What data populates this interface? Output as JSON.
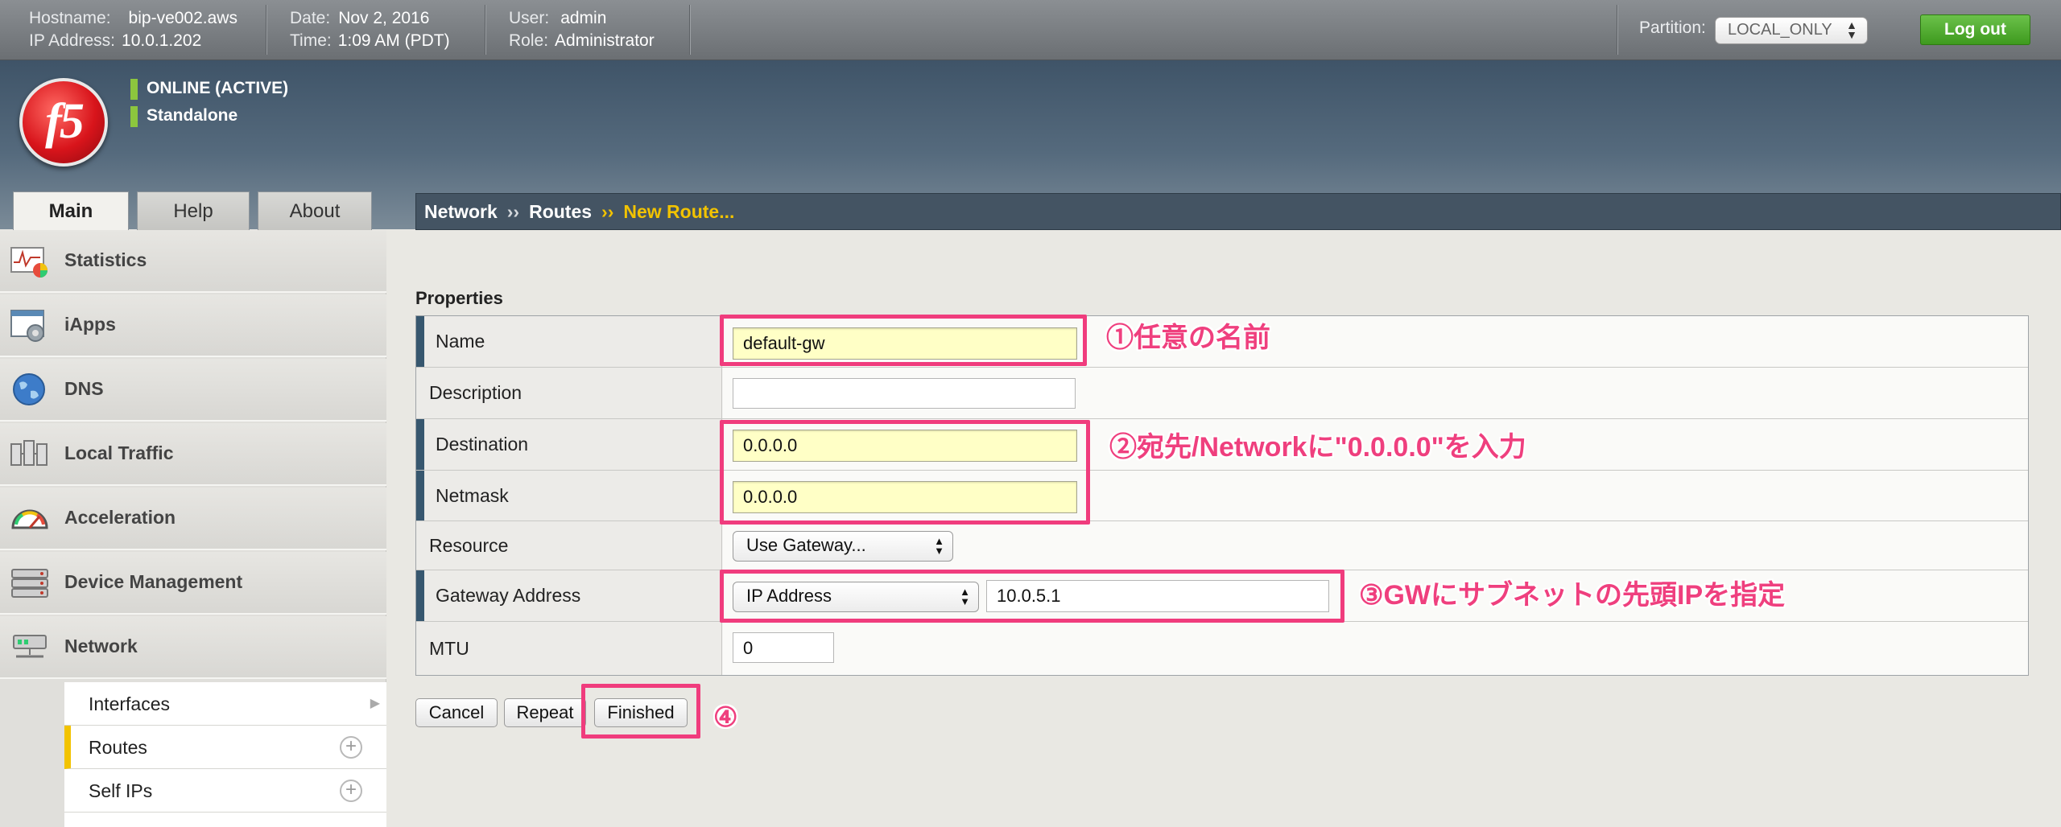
{
  "topbar": {
    "hostname_label": "Hostname:",
    "hostname": "bip-ve002.aws",
    "ip_label": "IP Address:",
    "ip": "10.0.1.202",
    "date_label": "Date:",
    "date": "Nov 2, 2016",
    "time_label": "Time:",
    "time": "1:09 AM (PDT)",
    "user_label": "User:",
    "user": "admin",
    "role_label": "Role:",
    "role": "Administrator",
    "partition_label": "Partition:",
    "partition_value": "LOCAL_ONLY",
    "logout_label": "Log out"
  },
  "header": {
    "logo_text": "f5",
    "status": "ONLINE (ACTIVE)",
    "mode": "Standalone"
  },
  "tabs": [
    {
      "label": "Main"
    },
    {
      "label": "Help"
    },
    {
      "label": "About"
    }
  ],
  "breadcrumb": {
    "items": [
      "Network",
      "Routes",
      "New Route..."
    ],
    "sep": "››"
  },
  "sidebar": {
    "items": [
      {
        "label": "Statistics",
        "icon": "statistics-icon"
      },
      {
        "label": "iApps",
        "icon": "iapps-icon"
      },
      {
        "label": "DNS",
        "icon": "dns-globe-icon"
      },
      {
        "label": "Local Traffic",
        "icon": "local-traffic-icon"
      },
      {
        "label": "Acceleration",
        "icon": "acceleration-gauge-icon"
      },
      {
        "label": "Device Management",
        "icon": "device-management-icon"
      },
      {
        "label": "Network",
        "icon": "network-icon"
      }
    ],
    "subitems": [
      {
        "label": "Interfaces"
      },
      {
        "label": "Routes"
      },
      {
        "label": "Self IPs"
      }
    ]
  },
  "form": {
    "section_title": "Properties",
    "rows": {
      "name": {
        "label": "Name",
        "value": "default-gw"
      },
      "description": {
        "label": "Description",
        "value": ""
      },
      "destination": {
        "label": "Destination",
        "value": "0.0.0.0"
      },
      "netmask": {
        "label": "Netmask",
        "value": "0.0.0.0"
      },
      "resource": {
        "label": "Resource",
        "value": "Use Gateway..."
      },
      "gateway": {
        "label": "Gateway Address",
        "type_value": "IP Address",
        "value": "10.0.5.1"
      },
      "mtu": {
        "label": "MTU",
        "value": "0"
      }
    },
    "buttons": {
      "cancel": "Cancel",
      "repeat": "Repeat",
      "finished": "Finished"
    }
  },
  "annotations": {
    "a1": "①任意の名前",
    "a2": "②宛先/Networkに\"0.0.0.0\"を入力",
    "a3": "③GWにサブネットの先頭IPを指定",
    "a4": "④",
    "color": "#ef3f7e"
  },
  "colors": {
    "accent_gold": "#f2c300",
    "breadcrumb_bg": "#445463",
    "logout_green": "#4fae2c",
    "status_green": "#8cc63e"
  }
}
